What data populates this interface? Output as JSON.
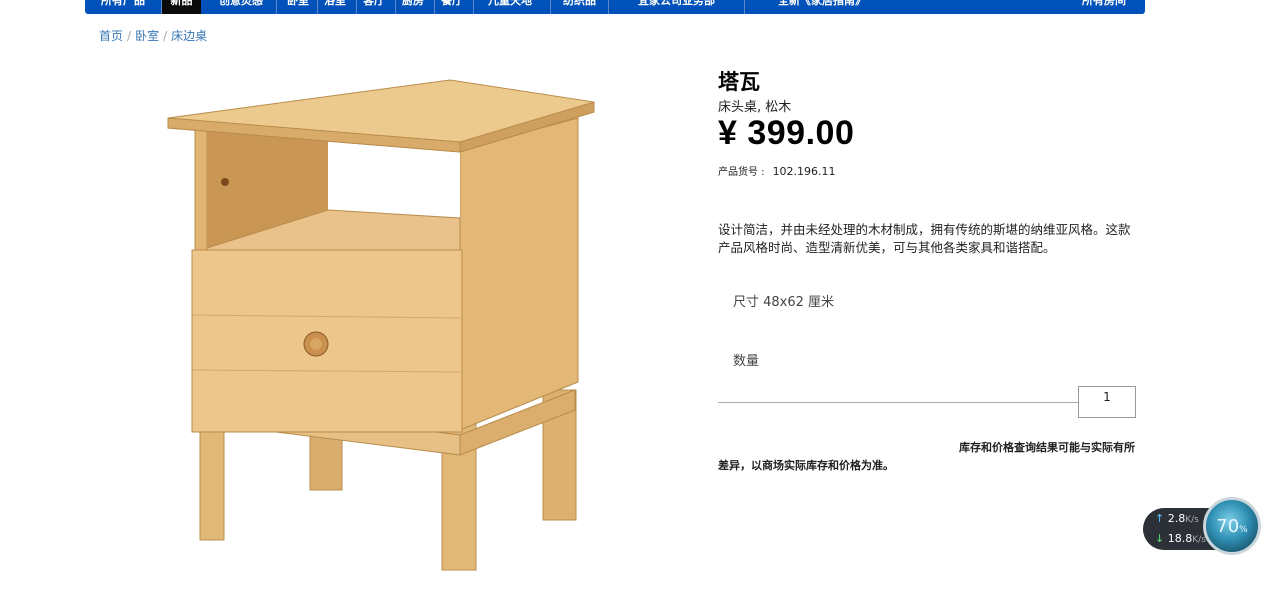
{
  "nav": {
    "items": [
      "所有产品",
      "新品",
      "创意灵感",
      "卧室",
      "浴室",
      "客厅",
      "厨房",
      "餐厅",
      "儿童天地",
      "纺织品",
      "宜家公司业务部",
      "全新《家居指南》",
      "所有房间"
    ],
    "active_index": 1
  },
  "breadcrumb": [
    "首页",
    "卧室",
    "床边桌"
  ],
  "product": {
    "name": "塔瓦",
    "subtitle": "床头桌, 松木",
    "price": "¥ 399.00",
    "sku_label": "产品货号 :",
    "sku": "102.196.11",
    "description": "设计简洁，并由未经处理的木材制成，拥有传统的斯堪的纳维亚风格。这款产品风格时尚、造型清新优美，可与其他各类家具和谐搭配。",
    "size_text": "尺寸 48x62 厘米",
    "quantity_label": "数量",
    "quantity_value": "1",
    "notice_line1": "库存和价格查询结果可能与实际有所",
    "notice_line2": "差异，以商场实际库存和价格为准。"
  },
  "net_widget": {
    "up_value": "2.8",
    "up_unit": "K/s",
    "down_value": "18.8",
    "down_unit": "K/s",
    "up_icon": "arrow-up-icon",
    "down_icon": "arrow-down-icon",
    "percent": "70",
    "percent_sign": "%"
  },
  "colors": {
    "nav_bg": "#0051ba",
    "link": "#3a78b5",
    "wood": "#e3bb7e"
  }
}
